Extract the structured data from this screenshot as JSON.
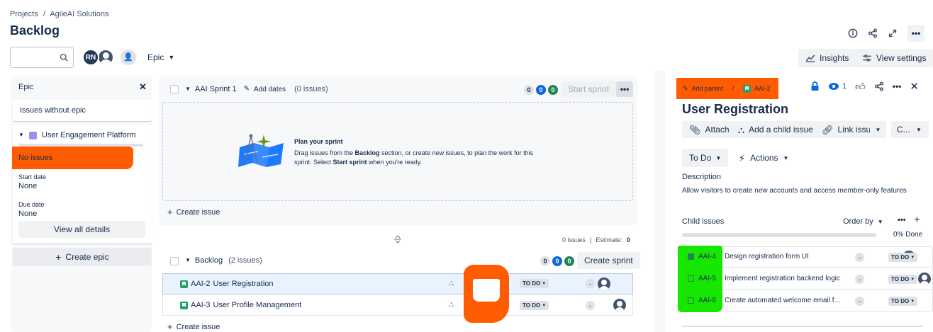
{
  "breadcrumb": {
    "projects": "Projects",
    "sep": "/",
    "project": "AgileAI Solutions"
  },
  "page_title": "Backlog",
  "toolbar": {
    "avatar_initials": "RN",
    "epic_filter": "Epic",
    "insights": "Insights",
    "view_settings": "View settings"
  },
  "epic_panel": {
    "title": "Epic",
    "issues_without_epic": "Issues without epic",
    "epic_name": "User Engagement Platform",
    "no_issues": "No issues",
    "start_date_label": "Start date",
    "start_date_value": "None",
    "due_date_label": "Due date",
    "due_date_value": "None",
    "view_all_details": "View all details",
    "create_epic": "Create epic",
    "epic_color": "#9f8fef"
  },
  "sprint": {
    "name": "AAI Sprint 1",
    "add_dates": "Add dates",
    "issue_count": "(0 issues)",
    "counts": [
      "0",
      "0",
      "0"
    ],
    "start_sprint": "Start sprint",
    "plan_title": "Plan your sprint",
    "plan_text_1": "Drag issues from the ",
    "plan_bold_1": "Backlog",
    "plan_text_2": " section, or create new issues, to plan the work for this sprint. Select ",
    "plan_bold_2": "Start sprint",
    "plan_text_3": " when you're ready.",
    "create_issue": "Create issue",
    "footer_issues": "0 issues",
    "footer_sep": "|",
    "footer_estimate_label": "Estimate:",
    "footer_estimate_value": "0"
  },
  "backlog": {
    "title": "Backlog",
    "issue_count": "(2 issues)",
    "counts": [
      "0",
      "0",
      "0"
    ],
    "create_sprint": "Create sprint",
    "create_issue": "Create issue",
    "rows": [
      {
        "key": "AAI-2",
        "summary": "User Registration",
        "status": "TO DO",
        "estimate": "-"
      },
      {
        "key": "AAI-3",
        "summary": "User Profile Management",
        "status": "TO DO",
        "estimate": "-"
      }
    ]
  },
  "detail": {
    "add_parent": "Add parent",
    "sep": "/",
    "issue_key": "AAI-2",
    "watchers": "1",
    "title": "User Registration",
    "attach": "Attach",
    "add_child": "Add a child issue",
    "link_issue": "Link issue",
    "more_c": "C...",
    "status": "To Do",
    "actions": "Actions",
    "description_label": "Description",
    "description_text": "Allow visitors to create new accounts and access member-only features",
    "child_issues_label": "Child issues",
    "order_by": "Order by",
    "progress_text": "0% Done",
    "progress_fraction": 0,
    "children": [
      {
        "key": "AAI-4",
        "summary": "Design registration form UI",
        "estimate": "-",
        "status": "TO DO"
      },
      {
        "key": "AAI-5",
        "summary": "Implement registration backend logic",
        "estimate": "-",
        "status": "TO DO"
      },
      {
        "key": "AAI-6",
        "summary": "Create automated welcome email f...",
        "estimate": "-",
        "status": "TO DO"
      }
    ]
  },
  "colors": {
    "accent": "#0c66e4",
    "redact_orange": "#ff5b00",
    "redact_green": "#17e600"
  }
}
